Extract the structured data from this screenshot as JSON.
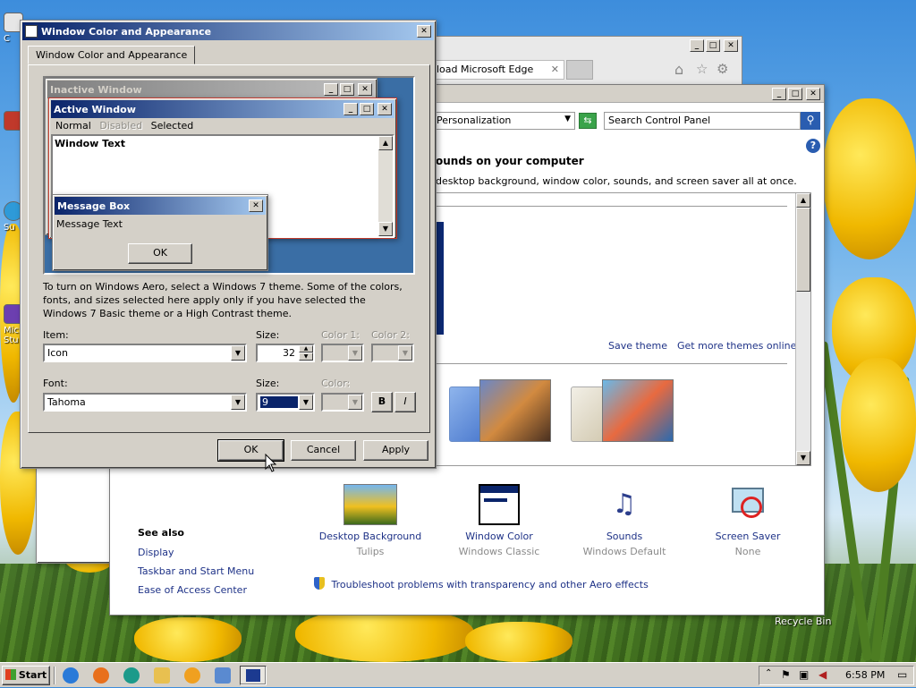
{
  "dialog": {
    "title": "Window Color and Appearance",
    "tab": "Window Color and Appearance",
    "preview": {
      "inactive_title": "Inactive Window",
      "active_title": "Active Window",
      "menu_normal": "Normal",
      "menu_disabled": "Disabled",
      "menu_selected": "Selected",
      "window_text": "Window Text",
      "msgbox_title": "Message Box",
      "msgbox_text": "Message Text",
      "msgbox_ok": "OK"
    },
    "info_text": "To turn on Windows Aero, select a Windows 7 theme.  Some of the colors, fonts, and sizes selected here apply only if you have selected the Windows 7 Basic theme or a High Contrast theme.",
    "item_label": "Item:",
    "item_value": "Icon",
    "size_label": "Size:",
    "size_value": "32",
    "color1_label": "Color 1:",
    "color2_label": "Color 2:",
    "font_label": "Font:",
    "font_value": "Tahoma",
    "font_size_label": "Size:",
    "font_size_value": "9",
    "font_color_label": "Color:",
    "bold_label": "B",
    "italic_label": "I",
    "ok": "OK",
    "cancel": "Cancel",
    "apply": "Apply"
  },
  "edge_window": {
    "tab_title": "load Microsoft Edge"
  },
  "control_panel": {
    "breadcrumb": "Personalization",
    "search_placeholder": "Search Control Panel",
    "heading": "ounds on your computer",
    "subtext": "desktop background, window color, sounds, and screen saver all at once.",
    "save_theme": "Save theme",
    "get_more_themes": "Get more themes online",
    "see_also": "See also",
    "see_also_links": [
      "Display",
      "Taskbar and Start Menu",
      "Ease of Access Center"
    ],
    "tiles": [
      {
        "title": "Desktop Background",
        "sub": "Tulips"
      },
      {
        "title": "Window Color",
        "sub": "Windows Classic"
      },
      {
        "title": "Sounds",
        "sub": "Windows Default"
      },
      {
        "title": "Screen Saver",
        "sub": "None"
      }
    ],
    "troubleshoot": "Troubleshoot problems with transparency and other Aero effects"
  },
  "desktop": {
    "recycle_bin": "Recycle Bin",
    "icon_labels": [
      "C",
      "Su",
      "Micr Stu"
    ]
  },
  "taskbar": {
    "start": "Start",
    "clock": "6:58 PM"
  },
  "colors": {
    "active_title_start": "#0a246a",
    "active_title_end": "#a6caf0",
    "face": "#d4d0c8",
    "desktop_preview": "#3a6ea5"
  }
}
